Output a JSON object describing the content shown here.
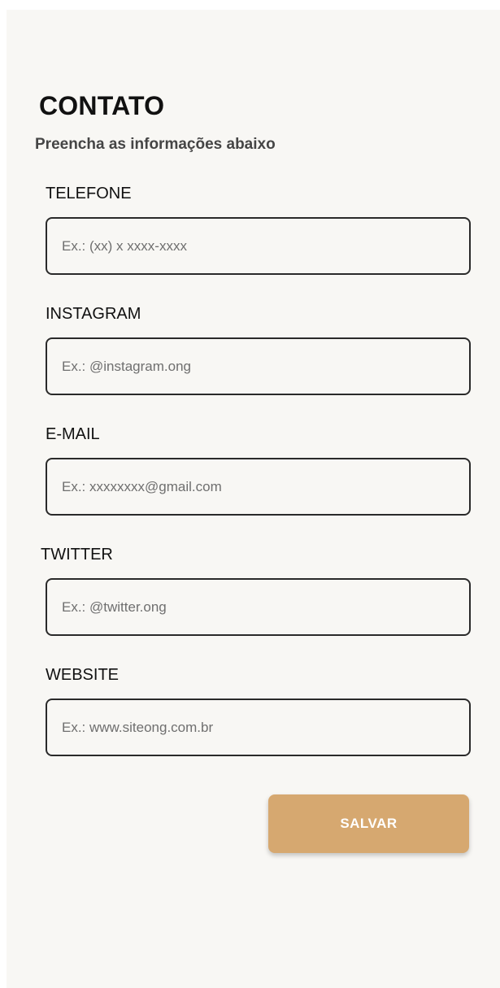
{
  "header": {
    "title": "CONTATO",
    "subtitle": "Preencha as informações abaixo"
  },
  "fields": [
    {
      "label": "TELEFONE",
      "placeholder": "Ex.: (xx) x xxxx-xxxx",
      "value": ""
    },
    {
      "label": "INSTAGRAM",
      "placeholder": "Ex.: @instagram.ong",
      "value": ""
    },
    {
      "label": "E-MAIL",
      "placeholder": "Ex.: xxxxxxxx@gmail.com",
      "value": ""
    },
    {
      "label": "TWITTER",
      "placeholder": "Ex.: @twitter.ong",
      "value": ""
    },
    {
      "label": "WEBSITE",
      "placeholder": "Ex.: www.siteong.com.br",
      "value": ""
    }
  ],
  "actions": {
    "save_label": "SALVAR"
  },
  "colors": {
    "background": "#f8f7f4",
    "accent": "#d6a870",
    "border": "#2a2a2a"
  }
}
